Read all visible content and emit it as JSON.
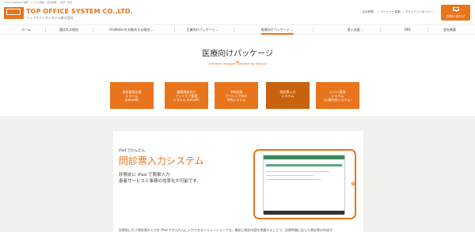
{
  "header": {
    "tagline": "Claris FileMaker 開発・システム構築・受託開発 ｜ 東京・埼玉",
    "brand": "TOP OFFICE SYSTEM CO.,LTD.",
    "brand_sub": "トップオフィスシステム株式会社",
    "util_links": [
      "会社概要",
      "パートナー募集",
      "プライバシーポリシー"
    ],
    "cta_label": "お問い合わせ"
  },
  "nav": {
    "items": [
      "ホーム",
      "選ばれる理由",
      "FileMakerをお勧めする理由 ⌄",
      "企業向けパッケージ ⌄",
      "医療向けパッケージ ⌄",
      "導入支援 ⌄",
      "BPA",
      "会社概要"
    ],
    "active_index": 4
  },
  "hero": {
    "title": "医療向けパッケージ",
    "subtitle": "FileMaker Packaged Software for Medical"
  },
  "tiles": [
    {
      "label": "透析管理支援\nシステム\ndotsoHD"
    },
    {
      "label": "腹膜透析向け\nフットケア管理\nシステム dotsoPC"
    },
    {
      "label": "予約記録\nクリニック向け\n予約システム"
    },
    {
      "label": "問診票入力\nシステム"
    },
    {
      "label": "心リハ管理\nシステム\n（心臓外科システム）"
    }
  ],
  "active_tile": 3,
  "feature": {
    "label": "iPad でかんたん",
    "title": "問診票入力システム",
    "desc": "診察前に iPad で簡単入力\n患者サービスと事務の効率化が可能です。",
    "body": "診察前に行う問診票の入力を iPad でかんたんに入力できるソリューションです。事前に問診内容を把握することで、診察時間に応じた問診票の作成が"
  },
  "colors": {
    "accent": "#e8741c",
    "accent_dark": "#c9620f",
    "page_bg": "#f1f0ec"
  },
  "icons": {
    "logo": "company-logo",
    "cta": "mail-icon",
    "device": "ipad-frame"
  }
}
